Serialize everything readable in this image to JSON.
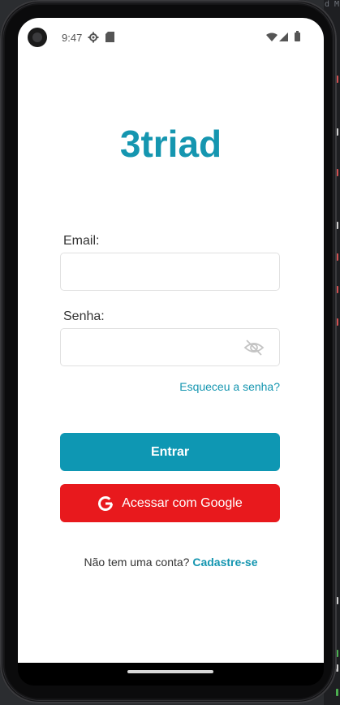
{
  "status_bar": {
    "time": "9:47"
  },
  "app": {
    "logo": "3triad",
    "email": {
      "label": "Email:",
      "value": ""
    },
    "password": {
      "label": "Senha:",
      "value": ""
    },
    "forgot_password": "Esqueceu a senha?",
    "login_button": "Entrar",
    "google_button": "Acessar com Google",
    "signup_prompt": "Não tem uma conta?",
    "signup_link": "Cadastre-se"
  },
  "colors": {
    "brand": "#1596b0",
    "google_red": "#e8191d"
  },
  "icons": [
    "gear-icon",
    "sd-card-icon",
    "wifi-icon",
    "signal-icon",
    "battery-icon",
    "eye-off-icon",
    "google-icon"
  ]
}
